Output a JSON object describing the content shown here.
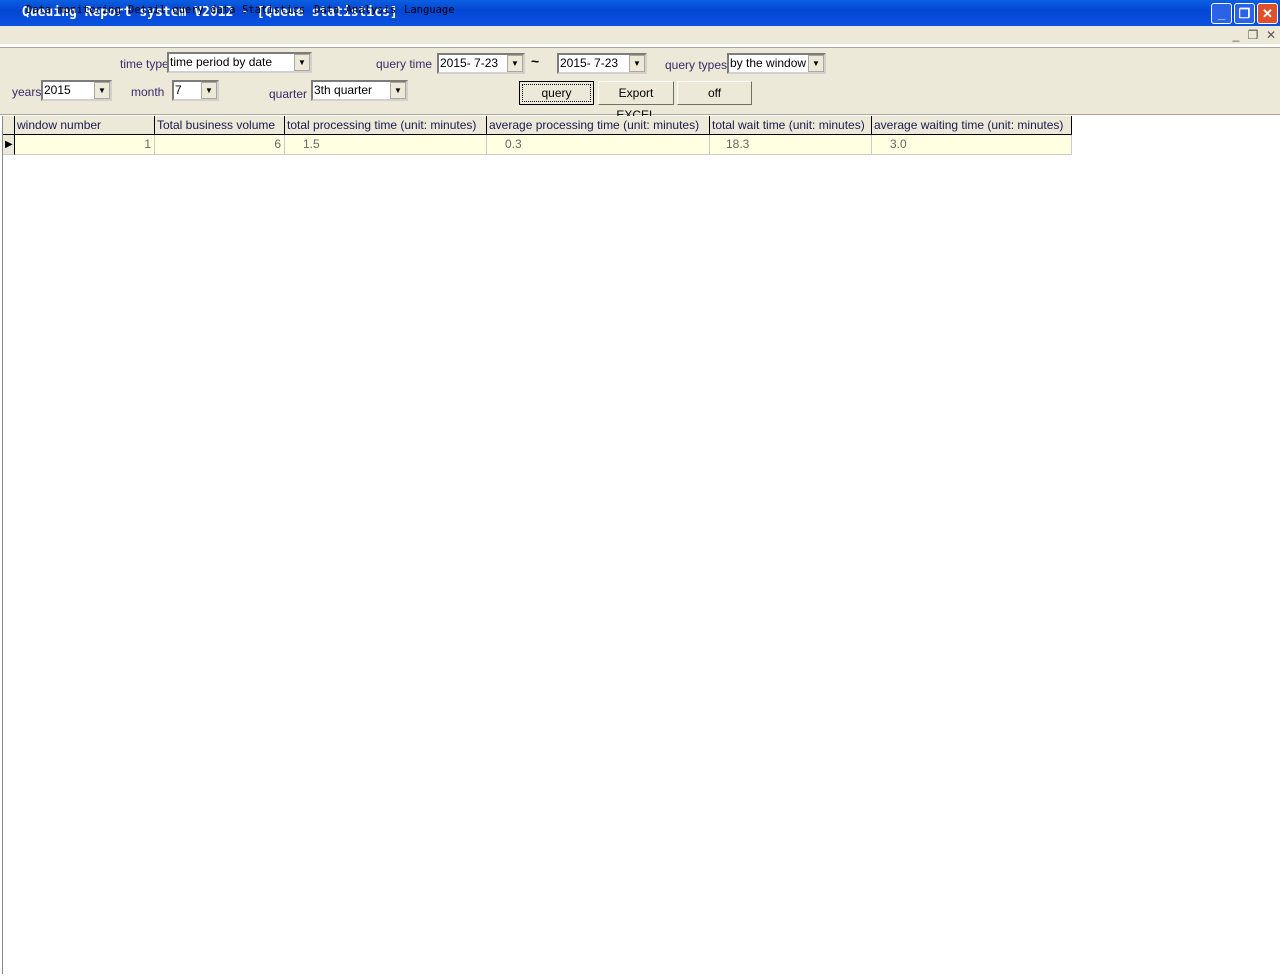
{
  "window": {
    "title": "Queuing Report system V2012 - [Queue statistics]"
  },
  "menu": [
    "Data monitoring",
    "Detail query data",
    "Statistics",
    "Data Analysis",
    "Language"
  ],
  "filters": {
    "time_type_label": "time type",
    "time_type_value": "time period by date",
    "query_time_label": "query time",
    "date_from": "2015- 7-23",
    "tilde": "~",
    "date_to": "2015- 7-23",
    "query_types_label": "query types",
    "query_types_value": "by the window",
    "years_label": "years",
    "years_value": "2015",
    "month_label": "month",
    "month_value": "7",
    "quarter_label": "quarter",
    "quarter_value": "3th quarter"
  },
  "buttons": {
    "query": "query",
    "export": "Export EXCEL",
    "off": "off"
  },
  "table": {
    "columns": [
      "window number",
      "Total business volume",
      "total processing time (unit: minutes)",
      "average processing time (unit: minutes)",
      "total wait time (unit: minutes)",
      "average waiting time (unit: minutes)"
    ],
    "rows": [
      [
        "1",
        "6",
        "1.5",
        "0.3",
        "18.3",
        "3.0"
      ]
    ]
  }
}
